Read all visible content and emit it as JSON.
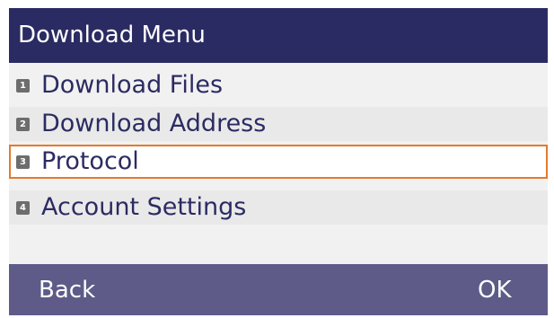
{
  "header": {
    "title": "Download Menu"
  },
  "menu": {
    "items": [
      {
        "number": "1",
        "label": "Download Files"
      },
      {
        "number": "2",
        "label": "Download Address"
      },
      {
        "number": "3",
        "label": "Protocol",
        "selected": true
      },
      {
        "number": "4",
        "label": "Account Settings"
      }
    ]
  },
  "softkeys": {
    "left": "Back",
    "right": "OK"
  },
  "colors": {
    "header": "#2b2b63",
    "softkey_bar": "#5e5b88",
    "selection_border": "#e37a2c"
  }
}
